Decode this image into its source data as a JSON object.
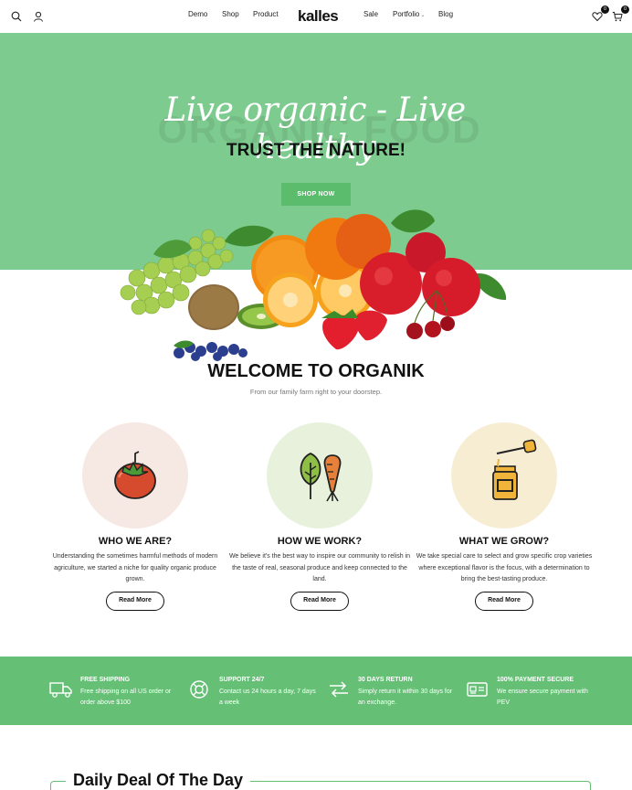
{
  "header": {
    "logo": "kalles",
    "nav": [
      {
        "label": "Demo"
      },
      {
        "label": "Shop"
      },
      {
        "label": "Product"
      },
      {
        "label": "Sale"
      },
      {
        "label": "Portfolio"
      },
      {
        "label": "Blog"
      }
    ],
    "wishlist_count": "0",
    "cart_count": "0",
    "icons": [
      "search-icon",
      "user-icon",
      "heart-icon",
      "cart-icon"
    ]
  },
  "hero": {
    "background_text": "ORGANIC FOOD",
    "script_title": "Live organic - Live healthy",
    "tagline": "TRUST THE NATURE!",
    "button_label": "SHOP NOW",
    "bg_color": "#7dcb8f"
  },
  "welcome": {
    "title": "WELCOME TO ORGANIK",
    "subtitle": "From our family farm right to your doorstep."
  },
  "features": [
    {
      "icon": "tomato-icon",
      "circle_color": "#f6e8e2",
      "title": "WHO WE ARE?",
      "text": "Understanding the sometimes harmful methods of modern agriculture, we started a niche for quality organic produce grown.",
      "button": "Read More"
    },
    {
      "icon": "vegetables-icon",
      "circle_color": "#e7f1dc",
      "title": "HOW WE WORK?",
      "text": "We believe it's the best way to inspire our community to relish in the taste of real, seasonal produce and keep connected to the land.",
      "button": "Read More"
    },
    {
      "icon": "honey-jar-icon",
      "circle_color": "#f7edd3",
      "title": "WHAT WE GROW?",
      "text": "We take special care to select and grow specific crop varieties where exceptional flavor is the focus, with a determination to bring the best-tasting produce.",
      "button": "Read More"
    }
  ],
  "services": [
    {
      "icon": "truck-icon",
      "title": "FREE SHIPPING",
      "text": "Free shipping on all US order or order above $100"
    },
    {
      "icon": "support-icon",
      "title": "SUPPORT 24/7",
      "text": "Contact us 24 hours a day, 7 days a week"
    },
    {
      "icon": "return-icon",
      "title": "30 DAYS RETURN",
      "text": "Simply return it within 30 days for an exchange."
    },
    {
      "icon": "payment-icon",
      "title": "100% PAYMENT SECURE",
      "text": "We ensure secure payment with PEV"
    }
  ],
  "deal": {
    "title": "Daily Deal Of The Day"
  },
  "colors": {
    "accent": "#65bf75",
    "hero": "#7dcb8f"
  }
}
